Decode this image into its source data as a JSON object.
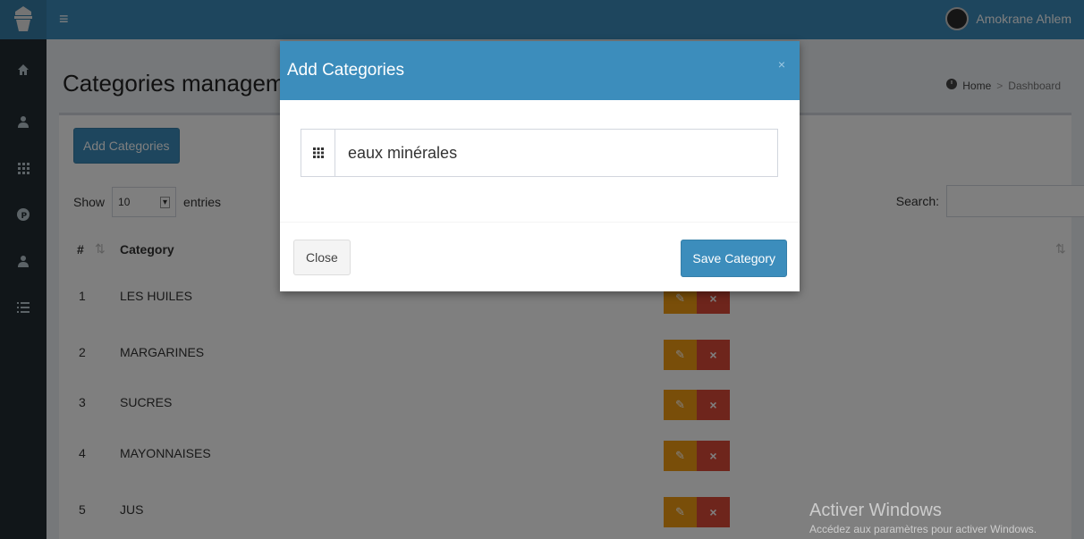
{
  "header": {
    "user_name": "Amokrane Ahlem"
  },
  "page": {
    "title": "Categories management",
    "breadcrumb": {
      "home": "Home",
      "current": "Dashboard"
    }
  },
  "toolbar": {
    "add_label": "Add Categories",
    "show_label": "Show",
    "entries_value": "10",
    "entries_label": "entries",
    "search_label": "Search:"
  },
  "table": {
    "columns": [
      "#",
      "Category"
    ],
    "rows": [
      {
        "id": "1",
        "category": "LES HUILES"
      },
      {
        "id": "2",
        "category": "MARGARINES"
      },
      {
        "id": "3",
        "category": "SUCRES"
      },
      {
        "id": "4",
        "category": "MAYONNAISES"
      },
      {
        "id": "5",
        "category": "JUS"
      }
    ]
  },
  "modal": {
    "title": "Add Categories",
    "close_x": "×",
    "field_value": "eaux minérales",
    "close_label": "Close",
    "save_label": "Save Category"
  },
  "watermark": {
    "line1": "Activer Windows",
    "line2": "Accédez aux paramètres pour activer Windows."
  },
  "colors": {
    "primary": "#3c8dbc",
    "sidebar": "#222d32",
    "warning": "#f39c12",
    "danger": "#dd4b39"
  }
}
